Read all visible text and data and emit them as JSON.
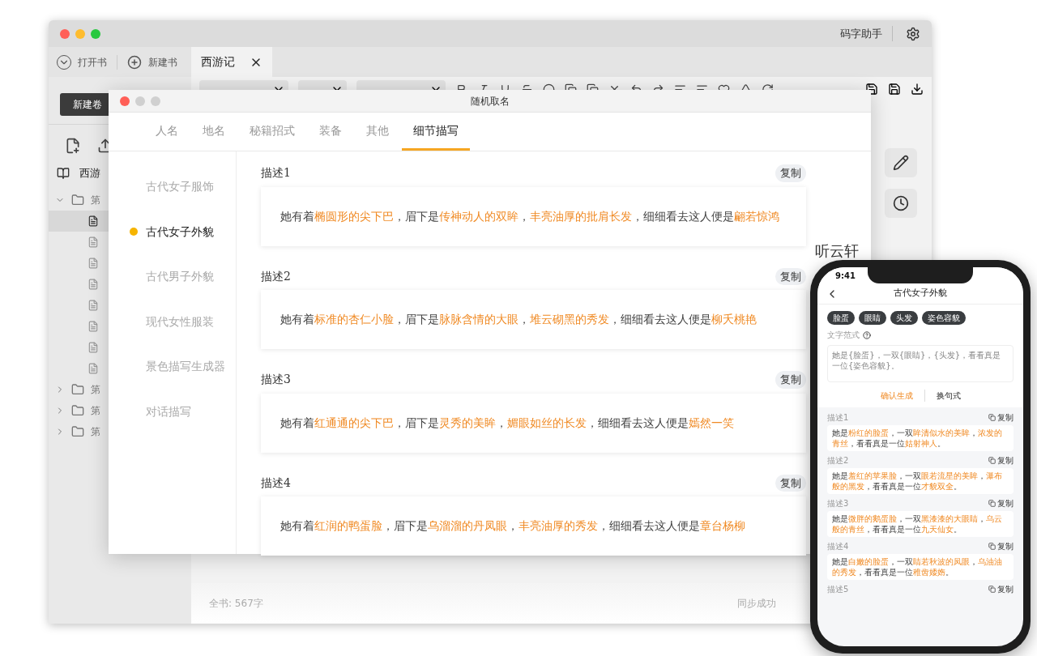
{
  "main_window": {
    "app_title": "码字助手",
    "toolbar_buttons": [
      {
        "kind": "open",
        "label": "打开书"
      },
      {
        "kind": "new",
        "label": "新建书"
      }
    ],
    "tabs": [
      {
        "label": "西游记",
        "selected": true
      }
    ],
    "new_volume": "新建卷",
    "book": "西游",
    "tree": [
      {
        "label": "第",
        "expanded": true,
        "children": [
          {
            "selected": true
          },
          {
            "selected": false
          },
          {
            "selected": false
          },
          {
            "selected": false
          },
          {
            "selected": false
          },
          {
            "selected": false
          },
          {
            "selected": false
          },
          {
            "selected": false
          }
        ]
      },
      {
        "label": "第",
        "expanded": false
      },
      {
        "label": "第",
        "expanded": false
      },
      {
        "label": "第",
        "expanded": false
      }
    ],
    "editor_heading": "听云轩",
    "status_left": "全书: 567字",
    "status_right": "同步成功"
  },
  "dialog": {
    "title": "随机取名",
    "tabs": [
      {
        "label": "人名",
        "selected": false
      },
      {
        "label": "地名",
        "selected": false
      },
      {
        "label": "秘籍招式",
        "selected": false
      },
      {
        "label": "装备",
        "selected": false
      },
      {
        "label": "其他",
        "selected": false
      },
      {
        "label": "细节描写",
        "selected": true
      }
    ],
    "categories": [
      {
        "label": "古代女子服饰",
        "selected": false
      },
      {
        "label": "古代女子外貌",
        "selected": true
      },
      {
        "label": "古代男子外貌",
        "selected": false
      },
      {
        "label": "现代女性服装",
        "selected": false
      },
      {
        "label": "景色描写生成器",
        "selected": false
      },
      {
        "label": "对话描写",
        "selected": false
      }
    ],
    "descriptions": [
      {
        "label": "描述1",
        "copy": "复制",
        "segments": [
          {
            "t": "她有着",
            "hl": false
          },
          {
            "t": "椭圆形的尖下巴",
            "hl": true
          },
          {
            "t": "，眉下是",
            "hl": false
          },
          {
            "t": "传神动人的双眸",
            "hl": true
          },
          {
            "t": "，",
            "hl": false
          },
          {
            "t": "丰亮油厚的批肩长发",
            "hl": true
          },
          {
            "t": "，细细看去这人便是",
            "hl": false
          },
          {
            "t": "翩若惊鸿",
            "hl": true
          }
        ]
      },
      {
        "label": "描述2",
        "copy": "复制",
        "segments": [
          {
            "t": "她有着",
            "hl": false
          },
          {
            "t": "标准的杏仁小脸",
            "hl": true
          },
          {
            "t": "，眉下是",
            "hl": false
          },
          {
            "t": "脉脉含情的大眼",
            "hl": true
          },
          {
            "t": "，",
            "hl": false
          },
          {
            "t": "堆云砌黑的秀发",
            "hl": true
          },
          {
            "t": "，细细看去这人便是",
            "hl": false
          },
          {
            "t": "柳夭桃艳",
            "hl": true
          }
        ]
      },
      {
        "label": "描述3",
        "copy": "复制",
        "segments": [
          {
            "t": "她有着",
            "hl": false
          },
          {
            "t": "红通通的尖下巴",
            "hl": true
          },
          {
            "t": "，眉下是",
            "hl": false
          },
          {
            "t": "灵秀的美眸",
            "hl": true
          },
          {
            "t": "，",
            "hl": false
          },
          {
            "t": "媚眼如丝的长发",
            "hl": true
          },
          {
            "t": "，细细看去这人便是",
            "hl": false
          },
          {
            "t": "嫣然一笑",
            "hl": true
          }
        ]
      },
      {
        "label": "描述4",
        "copy": "复制",
        "segments": [
          {
            "t": "她有着",
            "hl": false
          },
          {
            "t": "红润的鸭蛋脸",
            "hl": true
          },
          {
            "t": "，眉下是",
            "hl": false
          },
          {
            "t": "乌溜溜的丹凤眼",
            "hl": true
          },
          {
            "t": "，",
            "hl": false
          },
          {
            "t": "丰亮油厚的秀发",
            "hl": true
          },
          {
            "t": "，细细看去这人便是",
            "hl": false
          },
          {
            "t": "章台杨柳",
            "hl": true
          }
        ]
      }
    ]
  },
  "phone": {
    "time": "9:41",
    "title": "古代女子外貌",
    "chips": [
      "脸蛋",
      "眼睛",
      "头发",
      "姿色容貌"
    ],
    "template_label": "文字范式",
    "template_text": "她是{脸蛋}，一双{眼睛}，{头发}，看看真是一位{姿色容貌}。",
    "actions": [
      {
        "label": "确认生成",
        "kind": "primary"
      },
      {
        "label": "换句式",
        "kind": "secondary"
      }
    ],
    "descriptions": [
      {
        "label": "描述1",
        "copy": "复制",
        "segments": [
          {
            "t": "她是",
            "hl": false
          },
          {
            "t": "粉红的脸蛋",
            "hl": true
          },
          {
            "t": "，一双",
            "hl": false
          },
          {
            "t": "眸清似水的美眸",
            "hl": true
          },
          {
            "t": "，",
            "hl": false
          },
          {
            "t": "浓发的青丝",
            "hl": true
          },
          {
            "t": "，看看真是一位",
            "hl": false
          },
          {
            "t": "姑射神人",
            "hl": true
          },
          {
            "t": "。",
            "hl": false
          }
        ]
      },
      {
        "label": "描述2",
        "copy": "复制",
        "segments": [
          {
            "t": "她是",
            "hl": false
          },
          {
            "t": "羞红的苹果脸",
            "hl": true
          },
          {
            "t": "，一双",
            "hl": false
          },
          {
            "t": "眼若流星的美眸",
            "hl": true
          },
          {
            "t": "，",
            "hl": false
          },
          {
            "t": "瀑布般的黑发",
            "hl": true
          },
          {
            "t": "，看看真是一位",
            "hl": false
          },
          {
            "t": "才貌双全",
            "hl": true
          },
          {
            "t": "。",
            "hl": false
          }
        ]
      },
      {
        "label": "描述3",
        "copy": "复制",
        "segments": [
          {
            "t": "她是",
            "hl": false
          },
          {
            "t": "微胖的鹅蛋脸",
            "hl": true
          },
          {
            "t": "，一双",
            "hl": false
          },
          {
            "t": "黑漆漆的大眼睛",
            "hl": true
          },
          {
            "t": "，",
            "hl": false
          },
          {
            "t": "乌云般的青丝",
            "hl": true
          },
          {
            "t": "，看看真是一位",
            "hl": false
          },
          {
            "t": "九天仙女",
            "hl": true
          },
          {
            "t": "。",
            "hl": false
          }
        ]
      },
      {
        "label": "描述4",
        "copy": "复制",
        "segments": [
          {
            "t": "她是",
            "hl": false
          },
          {
            "t": "白嫩的脸蛋",
            "hl": true
          },
          {
            "t": "，一双",
            "hl": false
          },
          {
            "t": "睛若秋波的凤眼",
            "hl": true
          },
          {
            "t": "，",
            "hl": false
          },
          {
            "t": "乌油油的秀发",
            "hl": true
          },
          {
            "t": "，看看真是一位",
            "hl": false
          },
          {
            "t": "稚齿婑媠",
            "hl": true
          },
          {
            "t": "。",
            "hl": false
          }
        ]
      },
      {
        "label": "描述5",
        "copy": "复制"
      }
    ]
  }
}
